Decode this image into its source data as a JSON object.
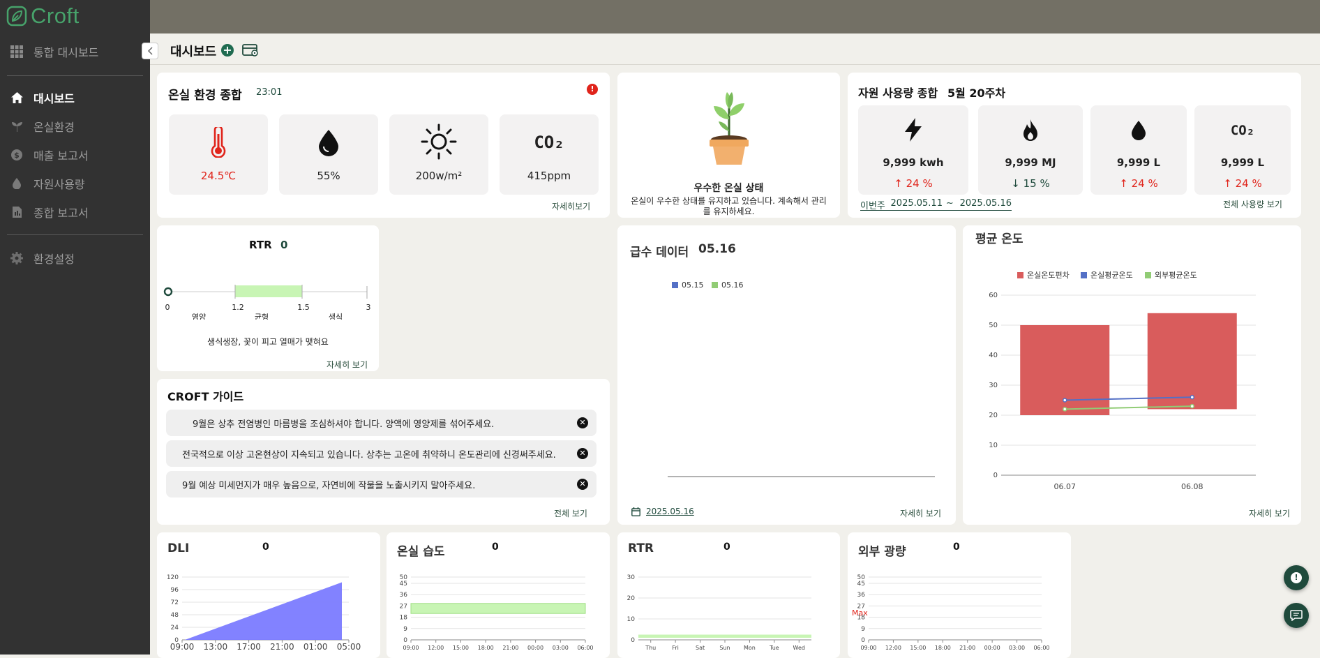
{
  "app": {
    "name": "Croft"
  },
  "sidebar": {
    "top": "통합 대시보드",
    "items": [
      {
        "label": "대시보드"
      },
      {
        "label": "온실환경"
      },
      {
        "label": "매출 보고서"
      },
      {
        "label": "자원사용량"
      },
      {
        "label": "종합 보고서"
      }
    ],
    "settings": "환경설정"
  },
  "page": {
    "title": "대시보드"
  },
  "env": {
    "title": "온실 환경 종합",
    "time": "23:01",
    "temp": "24.5℃",
    "humidity": "55%",
    "light": "200w/m²",
    "co2": "415ppm",
    "co2_icon": "CO₂",
    "more": "자세히보기",
    "alert": "!"
  },
  "status": {
    "title": "우수한 온실 상태",
    "desc": "온실이 우수한 상태를 유지하고 있습니다. 계속해서 관리를 유지하세요."
  },
  "resource": {
    "title": "자원 사용량 종합",
    "week": "5월 20주차",
    "tiles": [
      {
        "value": "9,999 kwh",
        "delta": "↑ 24 %",
        "color": "#e0241b"
      },
      {
        "value": "9,999 MJ",
        "delta": "↓ 15 %",
        "color": "#1f4a3c"
      },
      {
        "value": "9,999 L",
        "delta": "↑ 24 %",
        "color": "#e0241b"
      },
      {
        "value": "9,999 L",
        "delta": "↑ 24 %",
        "color": "#e0241b"
      }
    ],
    "period_label": "이번주",
    "start": "2025.05.11",
    "sep": "~",
    "end": "2025.05.16",
    "more": "전체 사용량 보기",
    "co2_icon": "CO₂"
  },
  "rtr_small": {
    "title": "RTR",
    "value": "0",
    "ticks": [
      "0",
      "1.2",
      "1.5",
      "3"
    ],
    "zones": [
      "영양",
      "균형",
      "생식"
    ],
    "desc": "생식생장, 꽃이 피고 열매가 맺혀요",
    "more": "자세히 보기"
  },
  "guide": {
    "title": "CROFT 가이드",
    "items": [
      "9월은 상추 전염병인 마름병을 조심하셔야 합니다. 양액에 영양제를 섞어주세요.",
      "전국적으로 이상 고온현상이 지속되고 있습니다. 상추는 고온에 취약하니 온도관리에 신경써주세요.",
      "9월 예상 미세먼지가 매우 높음으로, 자연비에 작물을 노출시키지 말아주세요."
    ],
    "more": "전체 보기",
    "close": "✕"
  },
  "water": {
    "title": "급수 데이터",
    "date": "05.16",
    "legend": [
      "05.15",
      "05.16"
    ],
    "footer_date": "2025.05.16",
    "more": "자세히 보기"
  },
  "avgtemp": {
    "title": "평균 온도",
    "legend": [
      "온실온도편차",
      "온실평균온도",
      "외부평균온도"
    ],
    "more": "자세히 보기"
  },
  "dli": {
    "title": "DLI",
    "value": "0"
  },
  "humid": {
    "title": "온실 습도",
    "value": "0"
  },
  "rtr": {
    "title": "RTR",
    "value": "0"
  },
  "outlight": {
    "title": "외부 광량",
    "value": "0",
    "max_label": "Max"
  },
  "fab": {
    "alert": "!"
  },
  "chart_data": [
    {
      "type": "bar",
      "title": "평균 온도",
      "categories": [
        "06.07",
        "06.08"
      ],
      "series": [
        {
          "name": "온실온도편차",
          "type": "floating-bar",
          "low": [
            20,
            22
          ],
          "high": [
            50,
            54
          ],
          "color": "#d95c5c"
        },
        {
          "name": "온실평균온도",
          "type": "line",
          "values": [
            25,
            26
          ],
          "color": "#5470c6"
        },
        {
          "name": "외부평균온도",
          "type": "line",
          "values": [
            22,
            23
          ],
          "color": "#91cc75"
        }
      ],
      "ylim": [
        0,
        60
      ],
      "yticks": [
        0,
        10,
        20,
        30,
        40,
        50,
        60
      ]
    },
    {
      "type": "area",
      "title": "DLI",
      "x": [
        "09:00",
        "13:00",
        "17:00",
        "21:00",
        "01:00",
        "05:00"
      ],
      "values": [
        0,
        22,
        44,
        66,
        88,
        110
      ],
      "ylim": [
        0,
        120
      ],
      "yticks": [
        0,
        24,
        48,
        72,
        96,
        120
      ],
      "color": "#7b7bff"
    },
    {
      "type": "line",
      "title": "온실 습도",
      "x": [
        "09:00",
        "12:00",
        "15:00",
        "18:00",
        "21:00",
        "00:00",
        "03:00",
        "06:00"
      ],
      "band": [
        21,
        29
      ],
      "ylim": [
        0,
        50
      ],
      "yticks": [
        0,
        9,
        18,
        27,
        36,
        45,
        50
      ]
    },
    {
      "type": "line",
      "title": "RTR",
      "x": [
        "Thu",
        "Fri",
        "Sat",
        "Sun",
        "Mon",
        "Tue",
        "Wed"
      ],
      "band": [
        1,
        2.5
      ],
      "ylim": [
        0,
        30
      ],
      "yticks": [
        0,
        10,
        20,
        30
      ]
    },
    {
      "type": "line",
      "title": "외부 광량",
      "x": [
        "09:00",
        "12:00",
        "15:00",
        "18:00",
        "21:00",
        "00:00",
        "03:00",
        "06:00"
      ],
      "ylim": [
        0,
        50
      ],
      "yticks": [
        0,
        9,
        18,
        27,
        36,
        45,
        50
      ]
    },
    {
      "type": "line",
      "title": "급수 데이터",
      "series": [
        {
          "name": "05.15",
          "color": "#5470c6"
        },
        {
          "name": "05.16",
          "color": "#91cc75"
        }
      ]
    }
  ]
}
